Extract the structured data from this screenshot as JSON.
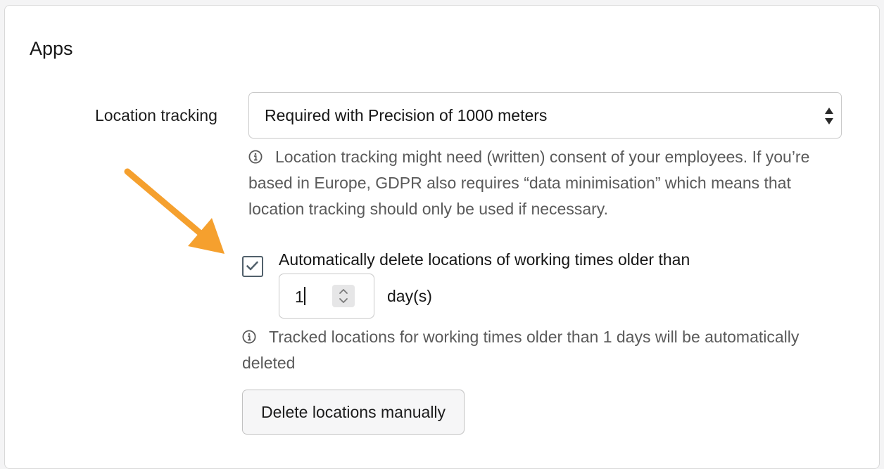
{
  "section": {
    "title": "Apps"
  },
  "location_tracking": {
    "label": "Location tracking",
    "selected_option": "Required with Precision of 1000 meters",
    "help_text": "Location tracking might need (written) consent of your employees. If you’re based in Europe, GDPR also requires “data minimisation” which means that location tracking should only be used if necessary."
  },
  "auto_delete": {
    "checked": true,
    "label": "Automatically delete locations of working times older than",
    "days_value": "1",
    "unit": "day(s)",
    "help_text": "Tracked locations for working times older than 1 days will be automatically deleted"
  },
  "actions": {
    "delete_manually_label": "Delete locations manually"
  },
  "colors": {
    "annotation_arrow": "#f5a02e",
    "checkbox_border": "#51606b",
    "help_text": "#5a5a5a"
  },
  "icons": {
    "select_arrows": "sort-arrows-icon",
    "help": "info-circle-icon",
    "checkbox": "checkmark-icon",
    "spinner": "spin-up-down-icon",
    "annotation": "annotation-arrow-icon"
  }
}
